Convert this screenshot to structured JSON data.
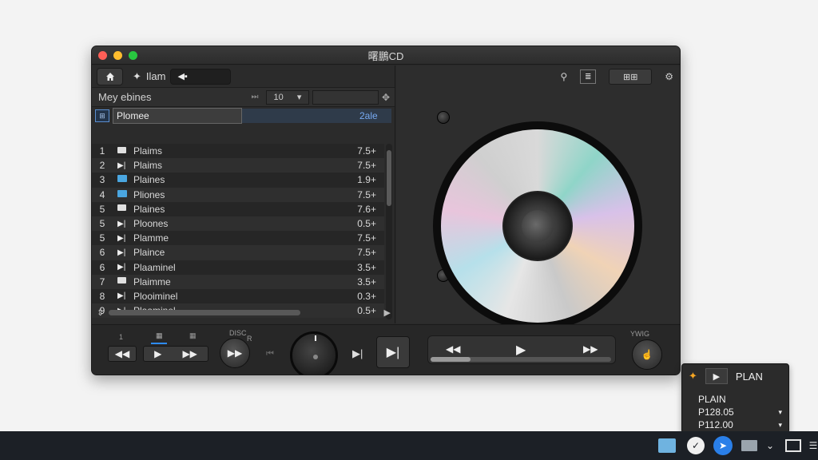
{
  "window": {
    "title": "曙鵬CD"
  },
  "toolbar": {
    "library_label": "Ilam",
    "toggle_label": "◀▪"
  },
  "subbar": {
    "title": "Mey ebines",
    "select_value": "10"
  },
  "search": {
    "checkbox": "⊞",
    "value": "Plomee",
    "count": "2ale"
  },
  "tracks": [
    {
      "num": "1",
      "icon": "folder",
      "name": "Plaims",
      "value": "7.5+"
    },
    {
      "num": "2",
      "icon": "play",
      "name": "Plaims",
      "value": "7.5+"
    },
    {
      "num": "3",
      "icon": "blue-folder",
      "name": "Plaines",
      "value": "1.9+"
    },
    {
      "num": "4",
      "icon": "blue-folder",
      "name": "Pliones",
      "value": "7.5+"
    },
    {
      "num": "5",
      "icon": "folder",
      "name": "Plaines",
      "value": "7.6+"
    },
    {
      "num": "5",
      "icon": "play",
      "name": "Ploones",
      "value": "0.5+"
    },
    {
      "num": "5",
      "icon": "play",
      "name": "Plamme",
      "value": "7.5+"
    },
    {
      "num": "6",
      "icon": "play",
      "name": "Plaince",
      "value": "7.5+"
    },
    {
      "num": "6",
      "icon": "play",
      "name": "Plaaminel",
      "value": "3.5+"
    },
    {
      "num": "7",
      "icon": "folder",
      "name": "Plaimme",
      "value": "3.5+"
    },
    {
      "num": "8",
      "icon": "play",
      "name": "Plooiminel",
      "value": "0.3+"
    },
    {
      "num": "9",
      "icon": "play",
      "name": "Plaaminel",
      "value": "0.5+"
    }
  ],
  "right_toolbar": {
    "pill_label": "⊞⊞"
  },
  "bottom": {
    "label_1": "1",
    "label_disc": "DISC",
    "label_b": "R",
    "label_y": "YWIG"
  },
  "playback_progress": 0.22,
  "popup": {
    "title": "PLAN",
    "heading": "PLAIN",
    "line1": "P128.05",
    "line2": "P112.00"
  }
}
